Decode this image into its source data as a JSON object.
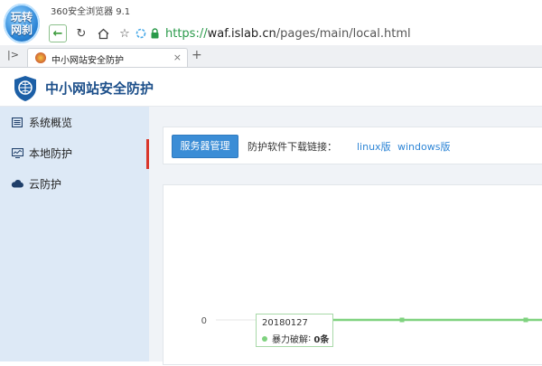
{
  "browser": {
    "brand_line1": "玩转",
    "brand_line2": "网刹",
    "window_title": "360安全浏览器 9.1",
    "url_scheme": "https://",
    "url_host": "waf.islab.cn",
    "url_path": "/pages/main/local.html",
    "tab_title": "中小网站安全防护",
    "new_tab": "+",
    "close_tab": "×"
  },
  "header": {
    "site_name": "中小网站安全防护"
  },
  "sidebar": {
    "items": [
      {
        "label": "系统概览",
        "icon": "list-icon"
      },
      {
        "label": "本地防护",
        "icon": "monitor-icon"
      },
      {
        "label": "云防护",
        "icon": "cloud-icon"
      }
    ],
    "active_index": 1
  },
  "toolbar": {
    "server_button": "服务器管理",
    "download_label": "防护软件下载链接：",
    "links": [
      "linux版",
      "windows版"
    ]
  },
  "chart_data": {
    "type": "line",
    "categories": [
      "20180127",
      "",
      "",
      ""
    ],
    "series": [
      {
        "name": "暴力破解",
        "values": [
          0,
          0,
          0,
          0
        ],
        "color": "#7fd27f"
      }
    ],
    "y_tick_labels": [
      "0"
    ],
    "tooltip": {
      "date": "20180127",
      "series": "暴力破解",
      "value": "0条"
    }
  },
  "colors": {
    "accent": "#3b8dd6",
    "active_indicator": "#d9362b",
    "series_green": "#7fd27f",
    "sidebar_bg": "#dde9f6"
  }
}
